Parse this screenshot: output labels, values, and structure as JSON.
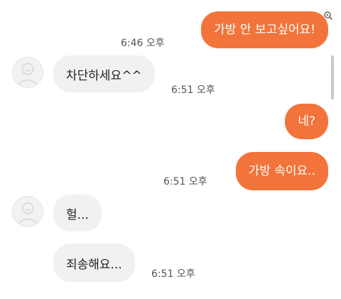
{
  "messages": [
    {
      "from": "me",
      "text": "가방 안 보고싶어요!",
      "time": "6:46 오후"
    },
    {
      "from": "other",
      "text": "차단하세요^^",
      "time": "6:51 오후"
    },
    {
      "from": "me",
      "text": "네?"
    },
    {
      "from": "me",
      "text": "가방 속이요..",
      "time": "6:51 오후"
    },
    {
      "from": "other",
      "text": "헐..."
    },
    {
      "from": "other",
      "text": "죄송해요...",
      "time": "6:51 오후"
    }
  ],
  "colors": {
    "outgoing_bubble": "#f2743a",
    "incoming_bubble": "#f1f1f4",
    "background": "#ffffff"
  },
  "icons": [
    "avatar-placeholder-icon",
    "lens-icon"
  ]
}
